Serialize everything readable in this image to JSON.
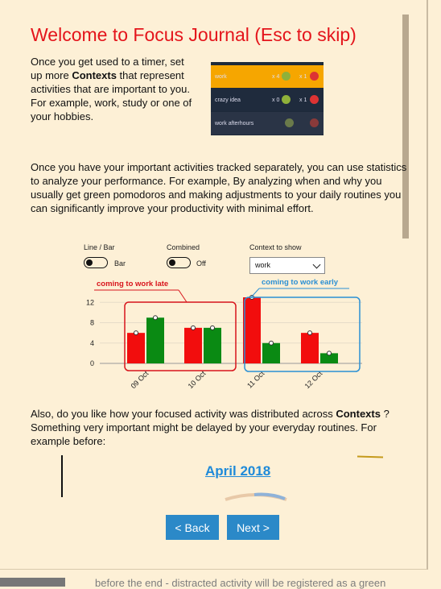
{
  "dialog": {
    "title": "Welcome to Focus Journal (Esc to skip)",
    "intro": {
      "part1": "Once you get used to a timer, set up more ",
      "bold": "Contexts",
      "part2": " that represent activities that are important to you. For example, work, study or one of your hobbies."
    },
    "paragraph2": "Once you have your important activities tracked separately, you can use statistics to analyze your performance. For example, By analyzing when and why you usually get green pomodoros and making adjustments to your daily routines you can significantly improve your productivity with minimal effort.",
    "paragraph3": {
      "part1": "Also, do you like how your focused activity was distributed across ",
      "bold": "Contexts",
      "part2": " ? Something very important might be delayed by your everyday routines. For example before:"
    },
    "month_label": "April 2018",
    "back_button": "< Back",
    "next_button": "Next >",
    "bottom_text": "before the end - distracted activity will be registered as a green"
  },
  "contexts_preview": [
    {
      "label": "work",
      "count": "x 4",
      "count2": "x 1"
    },
    {
      "label": "crazy idea",
      "count": "x 0",
      "count2": "x 1"
    },
    {
      "label": "work afterhours",
      "count": "",
      "count2": ""
    }
  ],
  "controls": {
    "line_bar_label": "Line / Bar",
    "line_bar_value": "Bar",
    "combined_label": "Combined",
    "combined_value": "Off",
    "context_label": "Context to show",
    "context_value": "work"
  },
  "annotations": {
    "late": "coming to work late",
    "early": "coming to work early"
  },
  "colors": {
    "title": "#e4141b",
    "red_bar": "#f20d0d",
    "green_bar": "#0a8a13",
    "late_box": "#d8141c",
    "early_box": "#2a8fd4",
    "button": "#2b89c8"
  },
  "chart_data": {
    "type": "bar",
    "categories": [
      "09 Oct",
      "10 Oct",
      "11 Oct",
      "12 Oct"
    ],
    "series": [
      {
        "values": [
          6,
          7,
          13,
          6
        ]
      },
      {
        "values": [
          9,
          7,
          4,
          2
        ]
      }
    ],
    "ylim": [
      0,
      13
    ],
    "yticks": [
      "0",
      "4",
      "8",
      "12"
    ],
    "grid": true
  }
}
